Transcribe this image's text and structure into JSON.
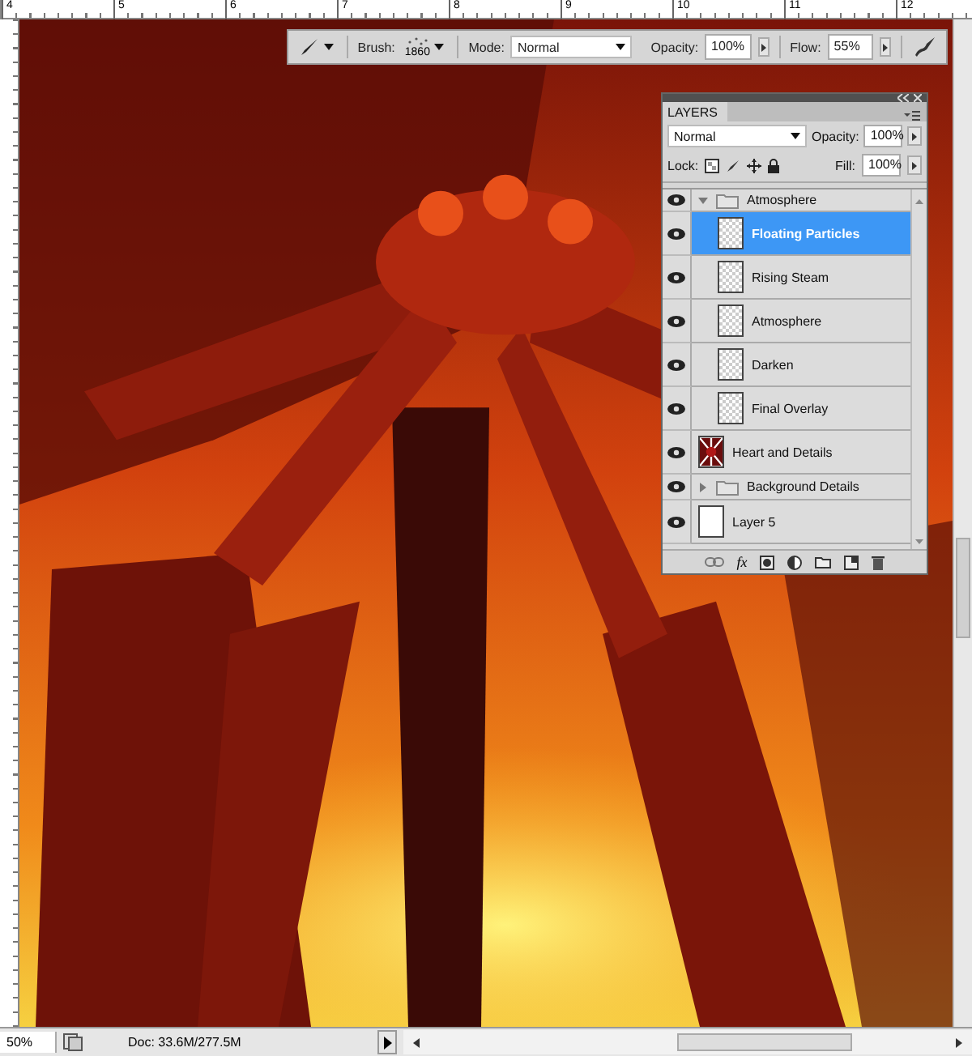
{
  "top_ruler": {
    "ticks": [
      "4",
      "5",
      "6",
      "7",
      "8",
      "9",
      "10",
      "11",
      "12"
    ]
  },
  "options_bar": {
    "brush_label": "Brush:",
    "brush_size": "1860",
    "mode_label": "Mode:",
    "mode": "Normal",
    "opacity_label": "Opacity:",
    "opacity": "100%",
    "flow_label": "Flow:",
    "flow": "55%"
  },
  "layers_panel": {
    "title": "LAYERS",
    "blend_mode": "Normal",
    "opacity_label": "Opacity:",
    "opacity": "100%",
    "lock_label": "Lock:",
    "fill_label": "Fill:",
    "fill": "100%",
    "fx_label": "fx",
    "layers": [
      {
        "name": "Atmosphere",
        "kind": "group",
        "expanded": true,
        "visible": true,
        "selected": false,
        "children": [
          {
            "name": "Floating Particles",
            "kind": "transparent",
            "visible": true,
            "selected": true
          },
          {
            "name": "Rising Steam",
            "kind": "transparent",
            "visible": true,
            "selected": false
          },
          {
            "name": "Atmosphere",
            "kind": "transparent",
            "visible": true,
            "selected": false
          },
          {
            "name": "Darken",
            "kind": "transparent",
            "visible": true,
            "selected": false
          },
          {
            "name": "Final Overlay",
            "kind": "transparent",
            "visible": true,
            "selected": false
          }
        ]
      },
      {
        "name": "Heart and Details",
        "kind": "artwork",
        "visible": true,
        "selected": false
      },
      {
        "name": "Background Details",
        "kind": "group",
        "expanded": false,
        "visible": true,
        "selected": false
      },
      {
        "name": "Layer 5",
        "kind": "white",
        "visible": true,
        "selected": false
      }
    ]
  },
  "status_bar": {
    "zoom": "50%",
    "doc": "Doc: 33.6M/277.5M"
  }
}
